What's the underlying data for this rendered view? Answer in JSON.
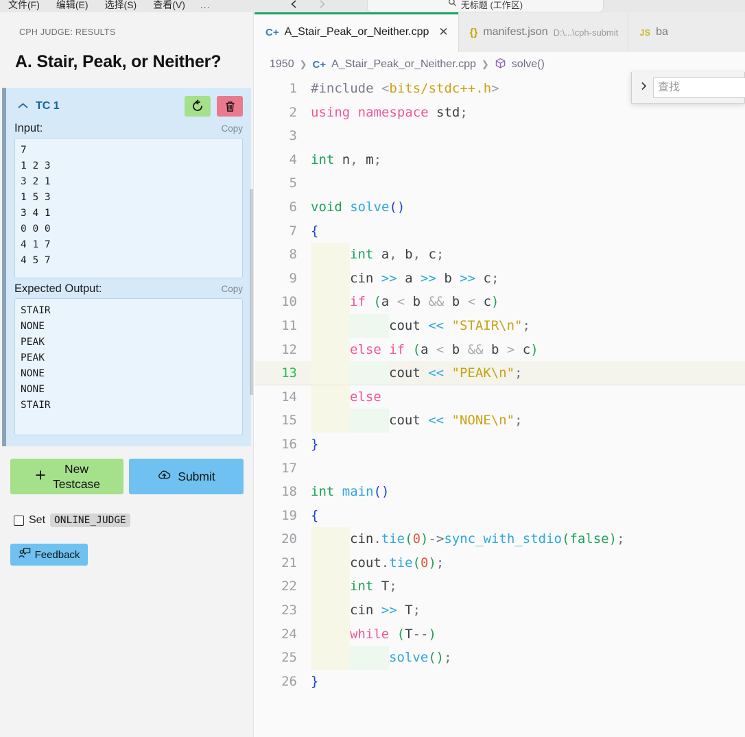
{
  "titlebar": {
    "menu_items": [
      "文件(F)",
      "编辑(E)",
      "选择(S)",
      "查看(V)"
    ],
    "overflow_label": "...",
    "back_icon": "arrow-left-icon",
    "forward_icon": "arrow-right-icon",
    "command_center": {
      "search_icon": "search-icon",
      "text": "无标题 (工作区)"
    }
  },
  "sidebar": {
    "panel_title": "CPH JUDGE: RESULTS",
    "problem_title": "A. Stair, Peak, or Neither?",
    "testcase": {
      "chevron_icon": "chevron-up-icon",
      "label": "TC 1",
      "rerun_icon": "rerun-icon",
      "delete_icon": "trash-icon",
      "input_label": "Input:",
      "input_copy_label": "Copy",
      "input_value": "7\n1 2 3\n3 2 1\n1 5 3\n3 4 1\n0 0 0\n4 1 7\n4 5 7",
      "expected_label": "Expected Output:",
      "expected_copy_label": "Copy",
      "expected_value": "STAIR\nNONE\nPEAK\nPEAK\nNONE\nNONE\nSTAIR"
    },
    "new_testcase_label": "New\nTestcase",
    "new_testcase_icon": "plus-icon",
    "submit_label": "Submit",
    "submit_icon": "cloud-upload-icon",
    "set_checkbox_label": "Set",
    "set_env_var": "ONLINE_JUDGE",
    "feedback_label": "Feedback",
    "feedback_icon": "person-comment-icon",
    "colors": {
      "card_bg": "#d6e9f8",
      "accent_bar": "#8ba3b8",
      "green": "#a5e08b",
      "pink": "#e9798f",
      "blue": "#6ec1f0"
    }
  },
  "editor": {
    "tabs": [
      {
        "icon": "cpp-file-icon",
        "label": "A_Stair_Peak_or_Neither.cpp",
        "dim": "",
        "active": true,
        "close_icon": "close-icon"
      },
      {
        "icon": "json-file-icon",
        "label": "manifest.json",
        "dim": "D:\\...\\cph-submit",
        "active": false,
        "close_icon": ""
      },
      {
        "icon": "js-file-icon",
        "label": "ba",
        "dim": "",
        "active": false,
        "close_icon": ""
      }
    ],
    "breadcrumb": [
      {
        "label": "1950",
        "icon": ""
      },
      {
        "label": "A_Stair_Peak_or_Neither.cpp",
        "icon": "cpp-file-icon"
      },
      {
        "label": "solve()",
        "icon": "symbol-cube-icon"
      }
    ],
    "find_widget": {
      "toggle_icon": "chevron-right-icon",
      "placeholder": "查找",
      "value": ""
    },
    "active_line": 13,
    "lines": [
      {
        "n": "1",
        "indent": 0,
        "tokens": [
          [
            "t-pre",
            "#include"
          ],
          [
            "t-plain",
            " "
          ],
          [
            "t-angle",
            "<"
          ],
          [
            "t-str",
            "bits/stdc++.h"
          ],
          [
            "t-angle",
            ">"
          ]
        ]
      },
      {
        "n": "2",
        "indent": 0,
        "tokens": [
          [
            "t-kw",
            "using namespace"
          ],
          [
            "t-plain",
            " "
          ],
          [
            "t-plain",
            "std"
          ],
          [
            "t-punc",
            ";"
          ]
        ]
      },
      {
        "n": "3",
        "indent": 0,
        "tokens": []
      },
      {
        "n": "4",
        "indent": 0,
        "tokens": [
          [
            "t-type",
            "int"
          ],
          [
            "t-plain",
            " n"
          ],
          [
            "t-punc",
            ", "
          ],
          [
            "t-plain",
            "m"
          ],
          [
            "t-punc",
            ";"
          ]
        ]
      },
      {
        "n": "5",
        "indent": 0,
        "tokens": []
      },
      {
        "n": "6",
        "indent": 0,
        "tokens": [
          [
            "t-type",
            "void"
          ],
          [
            "t-plain",
            " "
          ],
          [
            "t-fn",
            "solve"
          ],
          [
            "t-paren2",
            "()"
          ]
        ]
      },
      {
        "n": "7",
        "indent": 0,
        "tokens": [
          [
            "t-brace",
            "{"
          ]
        ]
      },
      {
        "n": "8",
        "indent": 1,
        "tokens": [
          [
            "t-type",
            "int"
          ],
          [
            "t-plain",
            " a"
          ],
          [
            "t-punc",
            ", "
          ],
          [
            "t-plain",
            "b"
          ],
          [
            "t-punc",
            ", "
          ],
          [
            "t-plain",
            "c"
          ],
          [
            "t-punc",
            ";"
          ]
        ]
      },
      {
        "n": "9",
        "indent": 1,
        "tokens": [
          [
            "t-plain",
            "cin "
          ],
          [
            "t-op",
            ">>"
          ],
          [
            "t-plain",
            " a "
          ],
          [
            "t-op",
            ">>"
          ],
          [
            "t-plain",
            " b "
          ],
          [
            "t-op",
            ">>"
          ],
          [
            "t-plain",
            " c"
          ],
          [
            "t-punc",
            ";"
          ]
        ]
      },
      {
        "n": "10",
        "indent": 1,
        "tokens": [
          [
            "t-kw",
            "if"
          ],
          [
            "t-plain",
            " "
          ],
          [
            "t-paren",
            "("
          ],
          [
            "t-plain",
            "a "
          ],
          [
            "t-amp",
            "<"
          ],
          [
            "t-plain",
            " b "
          ],
          [
            "t-amp",
            "&&"
          ],
          [
            "t-plain",
            " b "
          ],
          [
            "t-amp",
            "<"
          ],
          [
            "t-plain",
            " c"
          ],
          [
            "t-paren",
            ")"
          ]
        ]
      },
      {
        "n": "11",
        "indent": 2,
        "tokens": [
          [
            "t-plain",
            "cout "
          ],
          [
            "t-op",
            "<<"
          ],
          [
            "t-plain",
            " "
          ],
          [
            "t-str",
            "\"STAIR\\n\""
          ],
          [
            "t-punc",
            ";"
          ]
        ]
      },
      {
        "n": "12",
        "indent": 1,
        "tokens": [
          [
            "t-kw",
            "else if"
          ],
          [
            "t-plain",
            " "
          ],
          [
            "t-paren",
            "("
          ],
          [
            "t-plain",
            "a "
          ],
          [
            "t-amp",
            "<"
          ],
          [
            "t-plain",
            " b "
          ],
          [
            "t-amp",
            "&&"
          ],
          [
            "t-plain",
            " b "
          ],
          [
            "t-amp",
            ">"
          ],
          [
            "t-plain",
            " c"
          ],
          [
            "t-paren",
            ")"
          ]
        ]
      },
      {
        "n": "13",
        "indent": 2,
        "tokens": [
          [
            "t-plain",
            "cout "
          ],
          [
            "t-op",
            "<<"
          ],
          [
            "t-plain",
            " "
          ],
          [
            "t-str",
            "\"PEAK\\n\""
          ],
          [
            "t-punc",
            ";"
          ]
        ]
      },
      {
        "n": "14",
        "indent": 1,
        "tokens": [
          [
            "t-kw",
            "else"
          ]
        ]
      },
      {
        "n": "15",
        "indent": 2,
        "tokens": [
          [
            "t-plain",
            "cout "
          ],
          [
            "t-op",
            "<<"
          ],
          [
            "t-plain",
            " "
          ],
          [
            "t-str",
            "\"NONE\\n\""
          ],
          [
            "t-punc",
            ";"
          ]
        ]
      },
      {
        "n": "16",
        "indent": 0,
        "tokens": [
          [
            "t-brace",
            "}"
          ]
        ]
      },
      {
        "n": "17",
        "indent": 0,
        "tokens": []
      },
      {
        "n": "18",
        "indent": 0,
        "tokens": [
          [
            "t-type",
            "int"
          ],
          [
            "t-plain",
            " "
          ],
          [
            "t-fn",
            "main"
          ],
          [
            "t-paren2",
            "()"
          ]
        ]
      },
      {
        "n": "19",
        "indent": 0,
        "tokens": [
          [
            "t-brace",
            "{"
          ]
        ]
      },
      {
        "n": "20",
        "indent": 1,
        "tokens": [
          [
            "t-plain",
            "cin"
          ],
          [
            "t-punc",
            "."
          ],
          [
            "t-fn",
            "tie"
          ],
          [
            "t-paren",
            "("
          ],
          [
            "t-num",
            "0"
          ],
          [
            "t-paren",
            ")"
          ],
          [
            "t-punc",
            "->"
          ],
          [
            "t-fn",
            "sync_with_stdio"
          ],
          [
            "t-paren",
            "("
          ],
          [
            "t-bool",
            "false"
          ],
          [
            "t-paren",
            ")"
          ],
          [
            "t-punc",
            ";"
          ]
        ]
      },
      {
        "n": "21",
        "indent": 1,
        "tokens": [
          [
            "t-plain",
            "cout"
          ],
          [
            "t-punc",
            "."
          ],
          [
            "t-fn",
            "tie"
          ],
          [
            "t-paren",
            "("
          ],
          [
            "t-num",
            "0"
          ],
          [
            "t-paren",
            ")"
          ],
          [
            "t-punc",
            ";"
          ]
        ]
      },
      {
        "n": "22",
        "indent": 1,
        "tokens": [
          [
            "t-type",
            "int"
          ],
          [
            "t-plain",
            " T"
          ],
          [
            "t-punc",
            ";"
          ]
        ]
      },
      {
        "n": "23",
        "indent": 1,
        "tokens": [
          [
            "t-plain",
            "cin "
          ],
          [
            "t-op",
            ">>"
          ],
          [
            "t-plain",
            " T"
          ],
          [
            "t-punc",
            ";"
          ]
        ]
      },
      {
        "n": "24",
        "indent": 1,
        "tokens": [
          [
            "t-kw",
            "while"
          ],
          [
            "t-plain",
            " "
          ],
          [
            "t-paren",
            "("
          ],
          [
            "t-plain",
            "T"
          ],
          [
            "t-punc",
            "--"
          ],
          [
            "t-paren",
            ")"
          ]
        ]
      },
      {
        "n": "25",
        "indent": 2,
        "tokens": [
          [
            "t-fn",
            "solve"
          ],
          [
            "t-paren",
            "()"
          ],
          [
            "t-punc",
            ";"
          ]
        ]
      },
      {
        "n": "26",
        "indent": 0,
        "tokens": [
          [
            "t-brace",
            "}"
          ]
        ]
      }
    ]
  }
}
